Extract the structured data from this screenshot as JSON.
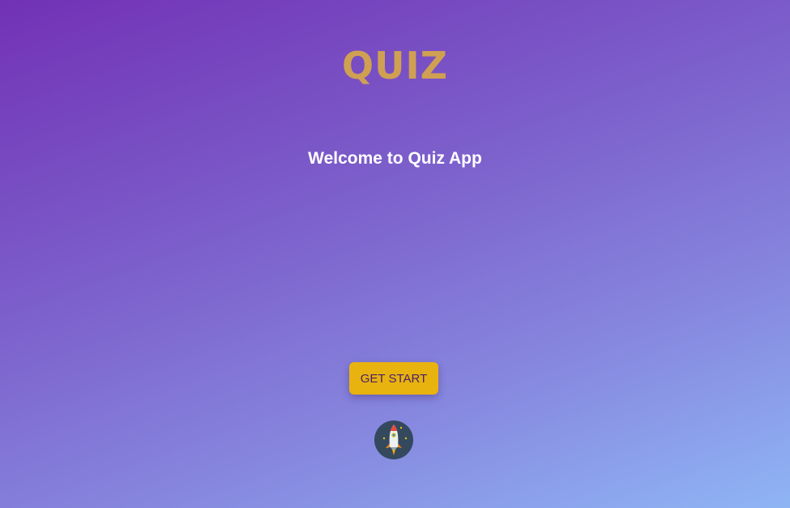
{
  "app": {
    "logo_text": "QUIZ",
    "welcome_text": "Welcome to Quiz App"
  },
  "actions": {
    "start_label": "GET START"
  },
  "icons": {
    "rocket": "rocket-icon"
  },
  "colors": {
    "gradient_start": "#7231b5",
    "gradient_end": "#8fb5f5",
    "logo": "#cfa052",
    "button_bg": "#e8b30f",
    "button_text": "#4a1e6b",
    "badge_bg": "#34495e"
  }
}
